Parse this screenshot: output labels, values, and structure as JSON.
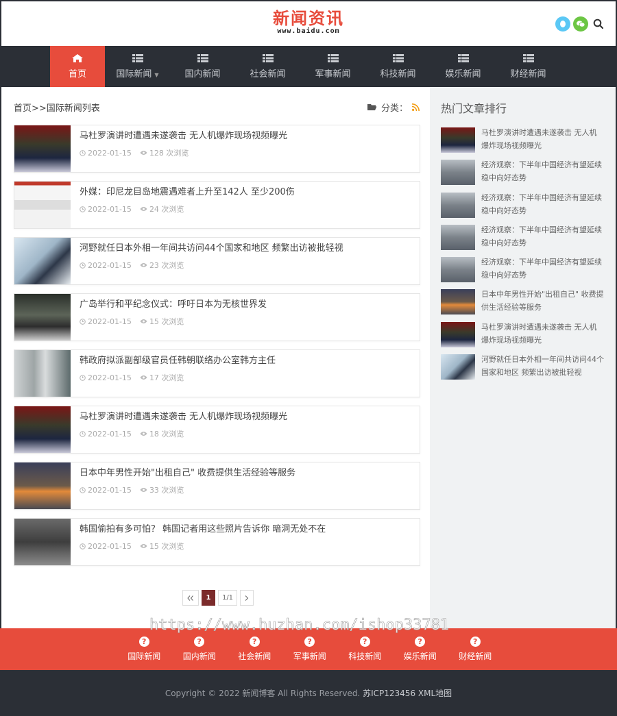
{
  "header": {
    "logo_main": "新闻资讯",
    "logo_sub": "www.baidu.com",
    "icons": [
      "qq-icon",
      "wechat-icon",
      "search-icon"
    ]
  },
  "nav": {
    "items": [
      {
        "label": "首页",
        "active": true
      },
      {
        "label": "国际新闻",
        "dropdown": true
      },
      {
        "label": "国内新闻"
      },
      {
        "label": "社会新闻"
      },
      {
        "label": "军事新闻"
      },
      {
        "label": "科技新闻"
      },
      {
        "label": "娱乐新闻"
      },
      {
        "label": "财经新闻"
      }
    ]
  },
  "breadcrumb": "首页>>国际新闻列表",
  "category_label": "分类：",
  "articles": [
    {
      "title": "马杜罗演讲时遭遇未遂袭击 无人机爆炸现场视频曝光",
      "date": "2022-01-15",
      "views": "128 次浏览"
    },
    {
      "title": "外媒：印尼龙目岛地震遇难者上升至142人 至少200伤",
      "date": "2022-01-15",
      "views": "24 次浏览"
    },
    {
      "title": "河野就任日本外相一年间共访问44个国家和地区 频繁出访被批轻视",
      "date": "2022-01-15",
      "views": "23 次浏览"
    },
    {
      "title": "广岛举行和平纪念仪式：呼吁日本为无核世界发",
      "date": "2022-01-15",
      "views": "15 次浏览"
    },
    {
      "title": "韩政府拟派副部级官员任韩朝联络办公室韩方主任",
      "date": "2022-01-15",
      "views": "17 次浏览"
    },
    {
      "title": "马杜罗演讲时遭遇未遂袭击 无人机爆炸现场视频曝光",
      "date": "2022-01-15",
      "views": "18 次浏览"
    },
    {
      "title": "日本中年男性开始\"出租自己\" 收费提供生活经验等服务",
      "date": "2022-01-15",
      "views": "33 次浏览"
    },
    {
      "title": "韩国偷拍有多可怕？ 韩国记者用这些照片告诉你 暗洞无处不在",
      "date": "2022-01-15",
      "views": "15 次浏览"
    }
  ],
  "pager": {
    "first": "«",
    "current": "1",
    "total": "1/1",
    "next": "›"
  },
  "sidebar": {
    "title": "热门文章排行",
    "items": [
      {
        "line1": "马杜罗演讲时遭遇未遂袭击 无人机",
        "line2": "爆炸现场视频曝光"
      },
      {
        "line1": "经济观察：下半年中国经济有望延续",
        "line2": "稳中向好态势"
      },
      {
        "line1": "经济观察：下半年中国经济有望延续",
        "line2": "稳中向好态势"
      },
      {
        "line1": "经济观察：下半年中国经济有望延续",
        "line2": "稳中向好态势"
      },
      {
        "line1": "经济观察：下半年中国经济有望延续",
        "line2": "稳中向好态势"
      },
      {
        "line1": "日本中年男性开始\"出租自己\" 收费提",
        "line2": "供生活经验等服务"
      },
      {
        "line1": "马杜罗演讲时遭遇未遂袭击 无人机",
        "line2": "爆炸现场视频曝光"
      },
      {
        "line1": "河野就任日本外相一年间共访问44个",
        "line2": "国家和地区 频繁出访被批轻视"
      }
    ]
  },
  "footer_nav": {
    "items": [
      "国际新闻",
      "国内新闻",
      "社会新闻",
      "军事新闻",
      "科技新闻",
      "娱乐新闻",
      "财经新闻"
    ]
  },
  "footer": {
    "copyright": "Copyright © 2022 新闻博客 All Rights Reserved.",
    "icp": "苏ICP123456",
    "sitemap": "XML地图"
  },
  "watermark": "https://www.huzhan.com/ishop33781",
  "colors": {
    "accent": "#e74c3c",
    "dark": "#2b2f36",
    "sidebar_bg": "#f0f2f3"
  }
}
